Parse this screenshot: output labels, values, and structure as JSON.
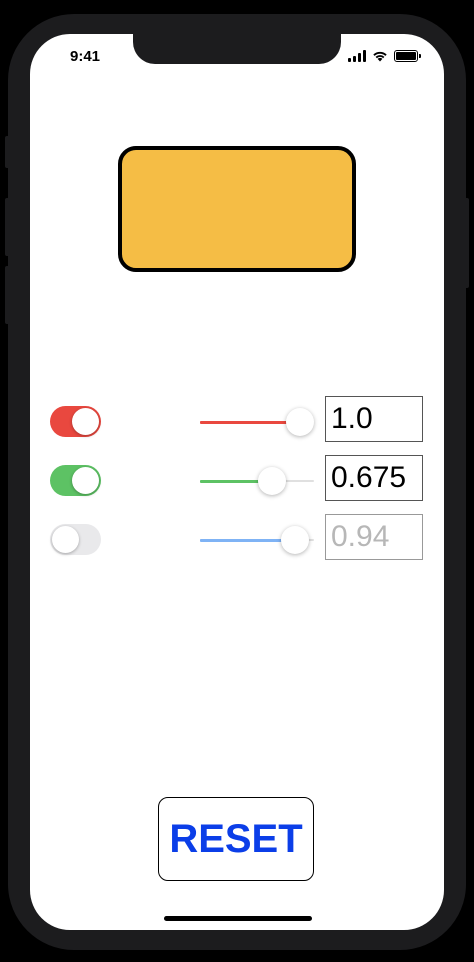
{
  "status_bar": {
    "time": "9:41",
    "icons": [
      "cellular-signal-icon",
      "wifi-icon",
      "battery-icon"
    ]
  },
  "preview": {
    "fill_color": "#F5BD45",
    "border_color": "#000000"
  },
  "channels": [
    {
      "name": "red",
      "enabled": true,
      "toggle_color": "#E9483F",
      "track_color": "#E9483F",
      "value": 1.0,
      "value_text": "1.0"
    },
    {
      "name": "green",
      "enabled": true,
      "toggle_color": "#5DC264",
      "track_color": "#5DC264",
      "value": 0.675,
      "value_text": "0.675"
    },
    {
      "name": "blue",
      "enabled": false,
      "toggle_color": "#E9E9EB",
      "track_color": "#7FB3F5",
      "value": 0.94,
      "value_text": "0.94"
    }
  ],
  "reset_button": {
    "label": "RESET",
    "color": "#0B3EE8"
  }
}
